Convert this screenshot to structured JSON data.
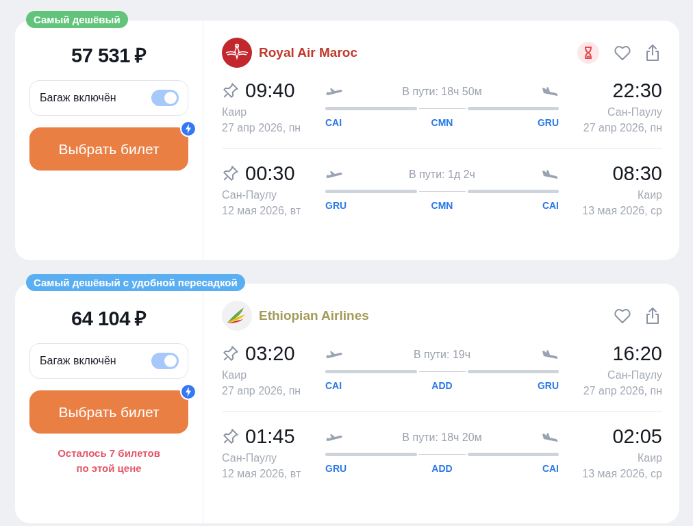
{
  "offers": [
    {
      "badge": {
        "text": "Самый дешёвый",
        "kind": "green"
      },
      "price": "57 531 ₽",
      "baggage": {
        "label": "Багаж включён",
        "on": true
      },
      "button": {
        "label": "Выбрать билет",
        "fast": true
      },
      "airline": {
        "name": "Royal Air Maroc",
        "color": "#c0392b",
        "kind": "crest",
        "timer": true
      },
      "legs": [
        {
          "dep_time": "09:40",
          "dep_city": "Каир",
          "dep_date": "27 апр 2026, пн",
          "duration": "В пути: 18ч 50м",
          "arr_time": "22:30",
          "arr_city": "Сан-Паулу",
          "arr_date": "27 апр 2026, пн",
          "from": "CAI",
          "to": "GRU",
          "segments": [
            {
              "kind": "flight"
            },
            {
              "kind": "layover",
              "code": "CMN"
            },
            {
              "kind": "flight"
            }
          ]
        },
        {
          "dep_time": "00:30",
          "dep_city": "Сан-Паулу",
          "dep_date": "12 мая 2026, вт",
          "duration": "В пути: 1д 2ч",
          "arr_time": "08:30",
          "arr_city": "Каир",
          "arr_date": "13 мая 2026, ср",
          "from": "GRU",
          "to": "CAI",
          "segments": [
            {
              "kind": "flight"
            },
            {
              "kind": "layover",
              "code": "CMN"
            },
            {
              "kind": "flight"
            }
          ]
        }
      ]
    },
    {
      "badge": {
        "text": "Самый дешёвый с удобной пересадкой",
        "kind": "blue"
      },
      "price": "64 104 ₽",
      "baggage": {
        "label": "Багаж включён",
        "on": true
      },
      "button": {
        "label": "Выбрать билет",
        "fast": true
      },
      "note": "Осталось 7 билетов по этой цене",
      "airline": {
        "name": "Ethiopian Airlines",
        "color": "#a39a5a",
        "kind": "wings",
        "timer": false
      },
      "legs": [
        {
          "dep_time": "03:20",
          "dep_city": "Каир",
          "dep_date": "27 апр 2026, пн",
          "duration": "В пути: 19ч",
          "arr_time": "16:20",
          "arr_city": "Сан-Паулу",
          "arr_date": "27 апр 2026, пн",
          "from": "CAI",
          "to": "GRU",
          "segments": [
            {
              "kind": "flight"
            },
            {
              "kind": "layover",
              "code": "ADD"
            },
            {
              "kind": "flight"
            }
          ]
        },
        {
          "dep_time": "01:45",
          "dep_city": "Сан-Паулу",
          "dep_date": "12 мая 2026, вт",
          "duration": "В пути: 18ч 20м",
          "arr_time": "02:05",
          "arr_city": "Каир",
          "arr_date": "13 мая 2026, ср",
          "from": "GRU",
          "to": "CAI",
          "segments": [
            {
              "kind": "flight"
            },
            {
              "kind": "layover",
              "code": "ADD"
            },
            {
              "kind": "flight"
            }
          ]
        }
      ]
    }
  ]
}
